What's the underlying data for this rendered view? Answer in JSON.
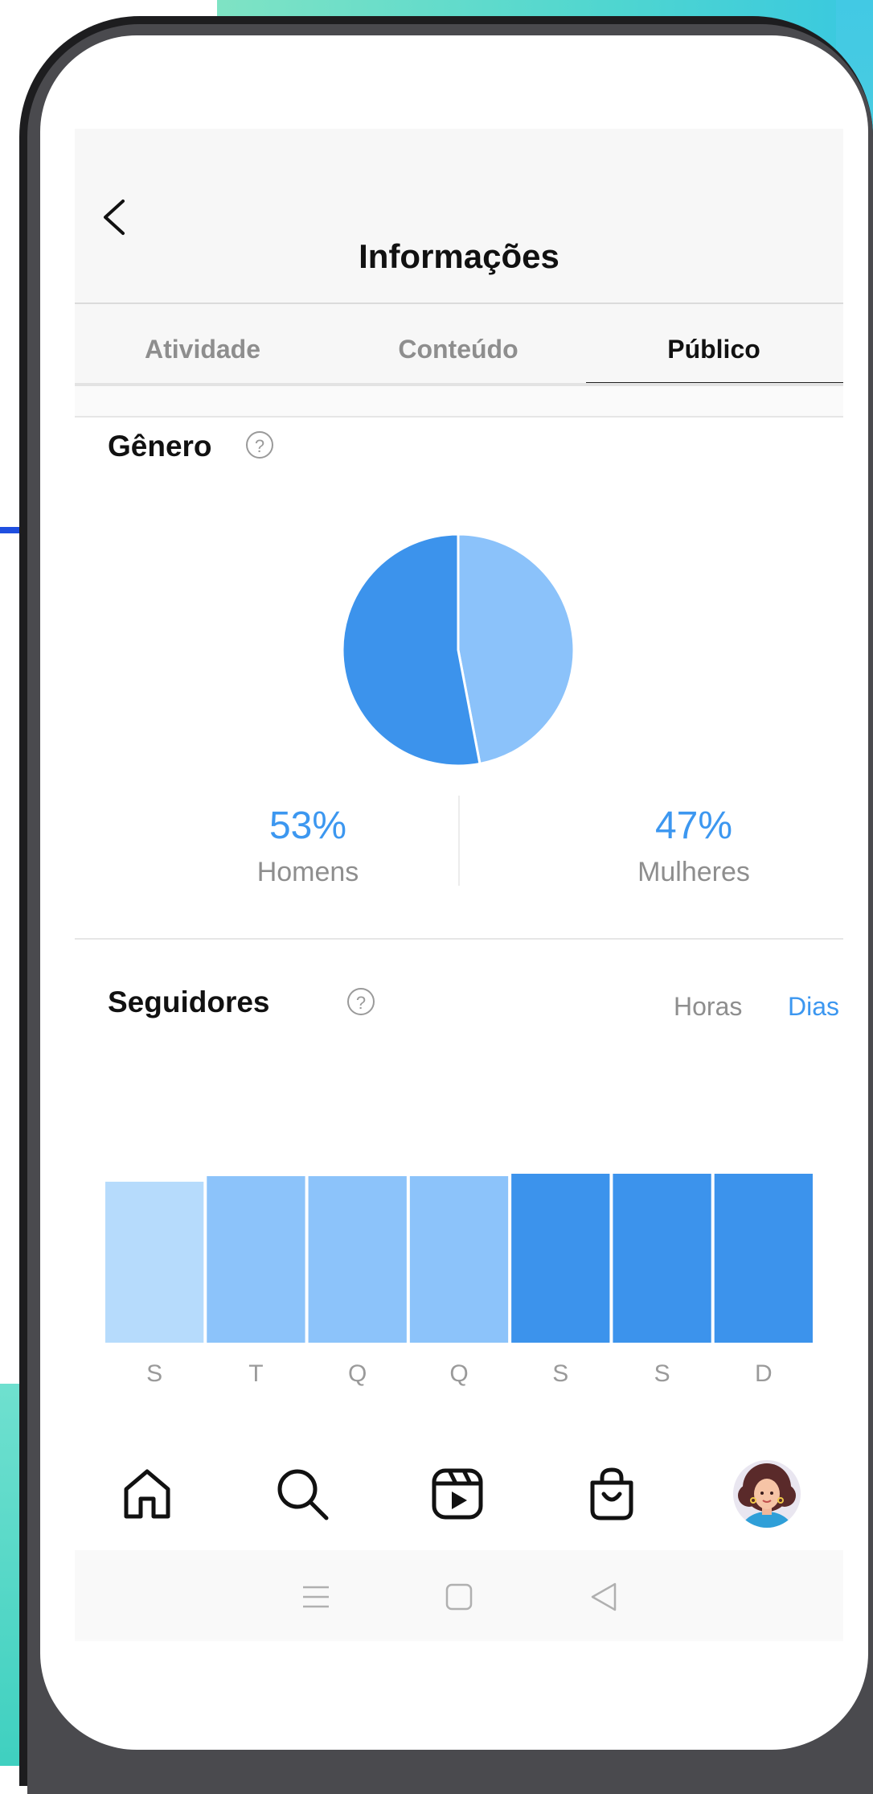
{
  "header": {
    "title": "Informações"
  },
  "tabs": [
    {
      "label": "Atividade",
      "active": false
    },
    {
      "label": "Conteúdo",
      "active": false
    },
    {
      "label": "Público",
      "active": true
    }
  ],
  "gender": {
    "title": "Gênero",
    "help": "?",
    "men": {
      "value": "53%",
      "label": "Homens",
      "color": "#3c93ec"
    },
    "women": {
      "value": "47%",
      "label": "Mulheres",
      "color": "#8bc2fa"
    }
  },
  "followers": {
    "title": "Seguidores",
    "help": "?",
    "toggle": {
      "hours": "Horas",
      "days": "Dias",
      "selected": "Dias"
    }
  },
  "chart_data": [
    {
      "type": "pie",
      "categories": [
        "Homens",
        "Mulheres"
      ],
      "values": [
        53,
        47
      ],
      "colors": [
        "#3c93ec",
        "#8bc2fa"
      ]
    },
    {
      "type": "bar",
      "categories": [
        "S",
        "T",
        "Q",
        "Q",
        "S",
        "S",
        "D"
      ],
      "values": [
        87,
        90,
        90,
        90,
        92,
        92.5,
        93
      ],
      "colors": [
        "#b6dbfc",
        "#8cc3fa",
        "#8cc3fa",
        "#8cc3fa",
        "#3c93ec",
        "#3c93ec",
        "#3c93ec"
      ],
      "title": "",
      "xlabel": "",
      "ylabel": ""
    }
  ],
  "nav": {
    "items": [
      "home-icon",
      "search-icon",
      "reels-icon",
      "shop-icon",
      "profile-avatar"
    ]
  },
  "system_nav": {
    "items": [
      "menu-icon",
      "home-square-icon",
      "back-triangle-icon"
    ]
  },
  "colors": {
    "accent": "#3c97f0",
    "muted": "#8e8e8e"
  }
}
